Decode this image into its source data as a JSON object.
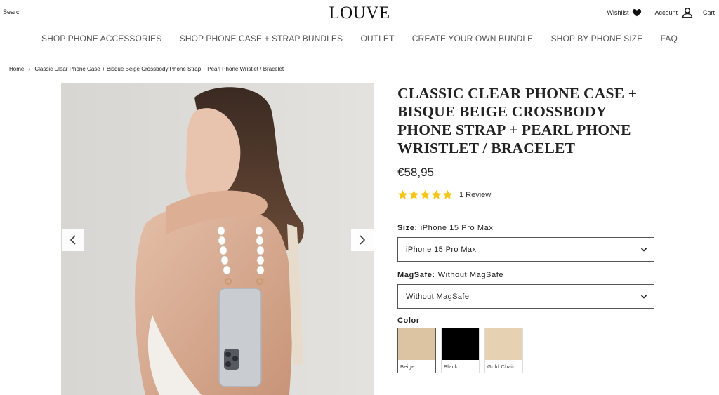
{
  "header": {
    "search_label": "Search",
    "logo_text": "LOUVE",
    "wishlist_label": "Wishlist",
    "account_label": "Account",
    "cart_label": "Cart"
  },
  "nav": {
    "items": [
      "SHOP PHONE ACCESSORIES",
      "SHOP PHONE CASE + STRAP BUNDLES",
      "OUTLET",
      "CREATE YOUR OWN BUNDLE",
      "SHOP BY PHONE SIZE",
      "FAQ"
    ]
  },
  "breadcrumb": {
    "home": "Home",
    "current": "Classic Clear Phone Case + Bisque Beige Crossbody Phone Strap + Pearl Phone Wristlet / Bracelet"
  },
  "product": {
    "title": "CLASSIC CLEAR PHONE CASE + BISQUE BEIGE CROSSBODY PHONE STRAP + PEARL PHONE WRISTLET / BRACELET",
    "price": "€58,95",
    "rating_stars": 5,
    "review_count": "1 Review",
    "size_label": "Size:",
    "size_value": "iPhone 15 Pro Max",
    "size_select_value": "iPhone 15 Pro Max",
    "magsafe_label": "MagSafe:",
    "magsafe_value": "Without MagSafe",
    "magsafe_select_value": "Without MagSafe",
    "color_label": "Color",
    "colors": [
      {
        "name": "Beige",
        "hex": "#dcc4a2",
        "selected": true
      },
      {
        "name": "Black",
        "hex": "#000000",
        "selected": false
      },
      {
        "name": "Gold Chain",
        "hex": "#e6d2b2",
        "selected": false
      }
    ]
  },
  "icons": {
    "prev": "chevron-left-icon",
    "next": "chevron-right-icon",
    "wishlist": "heart-icon",
    "account": "user-icon",
    "select": "chevron-down-icon"
  },
  "colors": {
    "star": "#f5c518",
    "text": "#222222",
    "nav_text": "#555555"
  }
}
